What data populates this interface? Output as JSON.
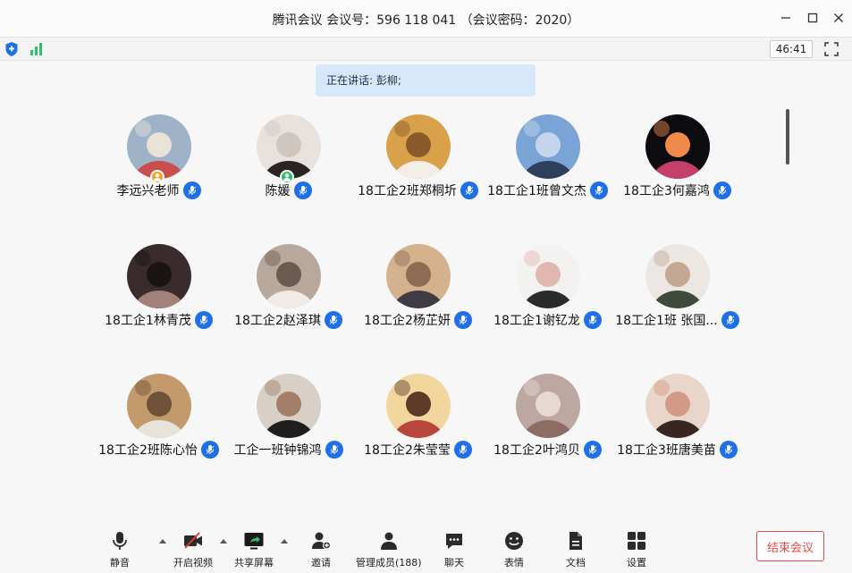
{
  "window": {
    "title": "腾讯会议 会议号：596 118 041 （会议密码：2020）"
  },
  "status": {
    "timer": "46:41"
  },
  "speaking": {
    "text": "正在讲话: 彭柳;"
  },
  "participants": [
    {
      "name": "李远兴老师",
      "badge": "host",
      "avatar_colors": [
        "#9fb3c8",
        "#c94f4f",
        "#e8e2d8"
      ]
    },
    {
      "name": "陈媛",
      "badge": "cohost",
      "avatar_colors": [
        "#e8e2de",
        "#2a2522",
        "#cfc6bf"
      ]
    },
    {
      "name": "18工企2班郑桐圻",
      "badge": "",
      "avatar_colors": [
        "#d9a24a",
        "#f3efe7",
        "#8a5a2b"
      ]
    },
    {
      "name": "18工企1班曾文杰",
      "badge": "",
      "avatar_colors": [
        "#7aa4d6",
        "#2e3f5c",
        "#c3d6ec"
      ]
    },
    {
      "name": "18工企3何嘉鸿",
      "badge": "",
      "avatar_colors": [
        "#0b0b10",
        "#c4406a",
        "#f08a4b"
      ]
    },
    {
      "name": "18工企1林青茂",
      "badge": "",
      "avatar_colors": [
        "#3a2c2c",
        "#a3807a",
        "#1b1414"
      ]
    },
    {
      "name": "18工企2赵泽琪",
      "badge": "",
      "avatar_colors": [
        "#b8a89c",
        "#f0ebe5",
        "#6a5a4f"
      ]
    },
    {
      "name": "18工企2杨芷妍",
      "badge": "",
      "avatar_colors": [
        "#d3b28d",
        "#3f3a44",
        "#8c6c54"
      ]
    },
    {
      "name": "18工企1谢钇龙",
      "badge": "",
      "avatar_colors": [
        "#f4f2f0",
        "#2b2b2b",
        "#e0b8b0"
      ]
    },
    {
      "name": "18工企1班 张国...",
      "badge": "",
      "avatar_colors": [
        "#ece7e2",
        "#3e4a3a",
        "#c4a894"
      ]
    },
    {
      "name": "18工企2班陈心怡",
      "badge": "",
      "avatar_colors": [
        "#c29a6c",
        "#e9e2d8",
        "#6e5338"
      ]
    },
    {
      "name": "工企一班钟锦鸿",
      "badge": "",
      "avatar_colors": [
        "#d8cfc6",
        "#1e1e1e",
        "#a27f66"
      ]
    },
    {
      "name": "18工企2朱莹莹",
      "badge": "",
      "avatar_colors": [
        "#f1d79e",
        "#b8463c",
        "#5c3a28"
      ]
    },
    {
      "name": "18工企2叶鸿贝",
      "badge": "",
      "avatar_colors": [
        "#bda7a1",
        "#8d6c64",
        "#e7d9d2"
      ]
    },
    {
      "name": "18工企3班唐美苗",
      "badge": "",
      "avatar_colors": [
        "#e9d6cb",
        "#3a2621",
        "#d39a88"
      ]
    }
  ],
  "toolbar": {
    "mute": "静音",
    "video": "开启视频",
    "share": "共享屏幕",
    "invite": "邀请",
    "members": "管理成员(188)",
    "chat": "聊天",
    "reaction": "表情",
    "docs": "文档",
    "settings": "设置",
    "end": "结束会议"
  },
  "colors": {
    "accent": "#1f6fe8",
    "end": "#e34b4b",
    "host_badge": "#f5a623",
    "cohost_badge": "#2fbf71",
    "signal": "#2fbf71"
  }
}
